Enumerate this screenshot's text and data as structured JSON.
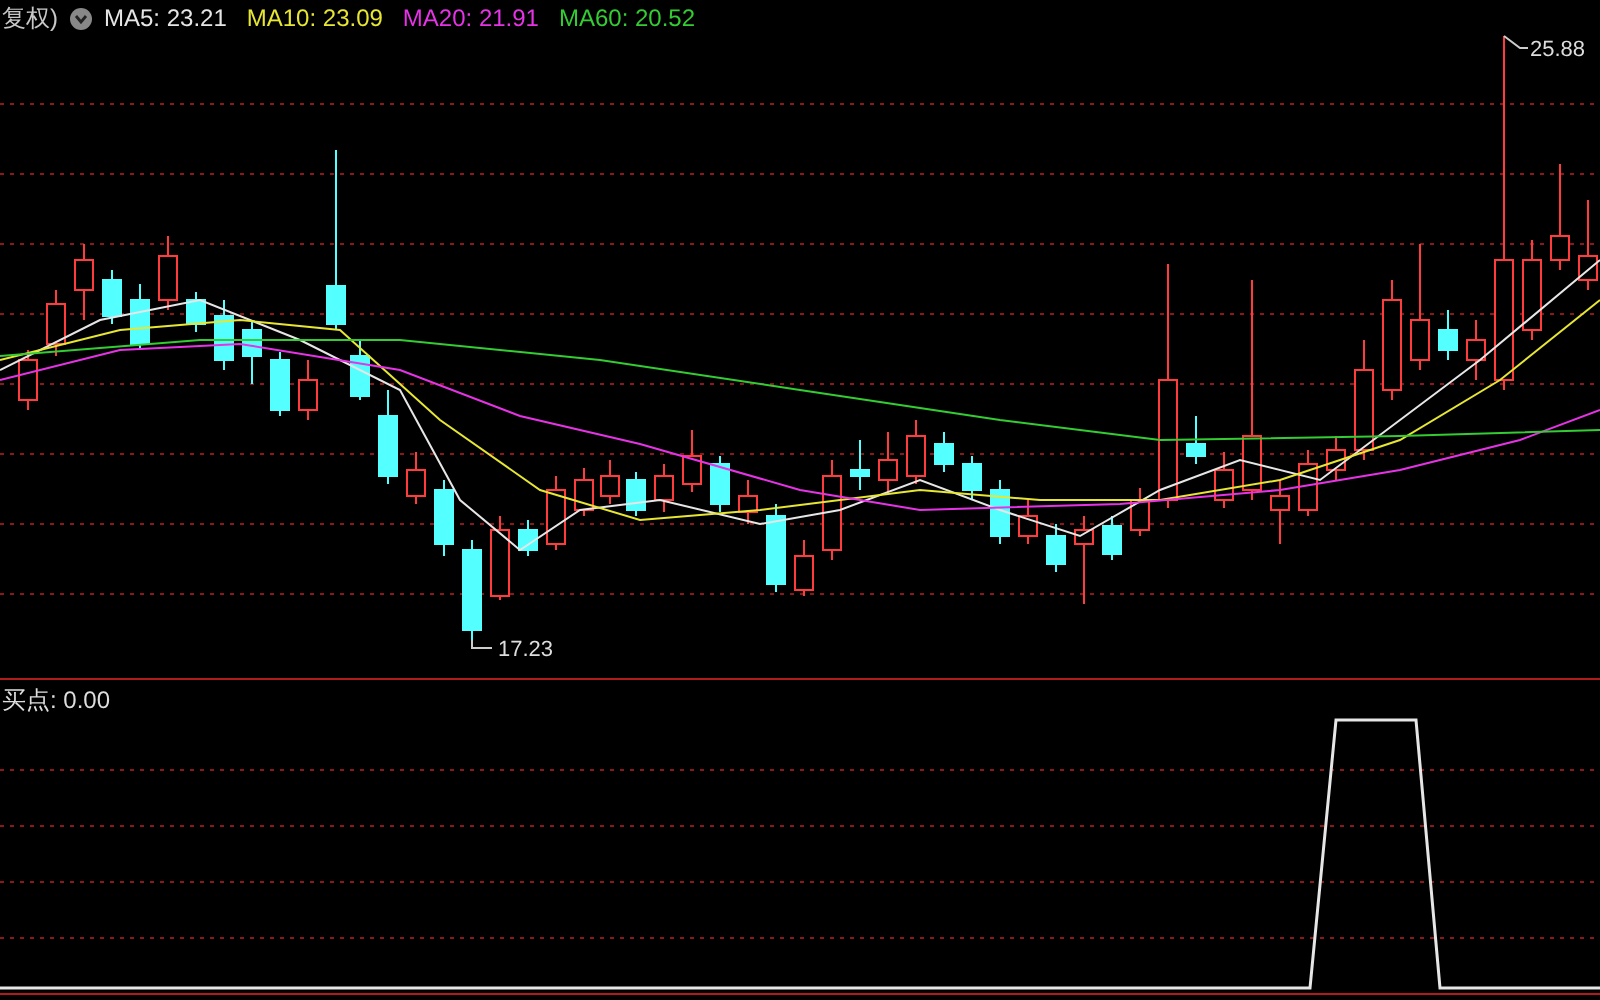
{
  "legend": {
    "mode": "复权)",
    "items": [
      {
        "label": "MA5: 23.21",
        "color": "#e6e6e6"
      },
      {
        "label": "MA10: 23.09",
        "color": "#e6e633"
      },
      {
        "label": "MA20: 21.91",
        "color": "#e633e6"
      },
      {
        "label": "MA60: 20.52",
        "color": "#33cc33"
      }
    ]
  },
  "price_labels": {
    "high": "25.88",
    "low": "17.23"
  },
  "indicator": {
    "label": "买点: 0.00"
  }
}
